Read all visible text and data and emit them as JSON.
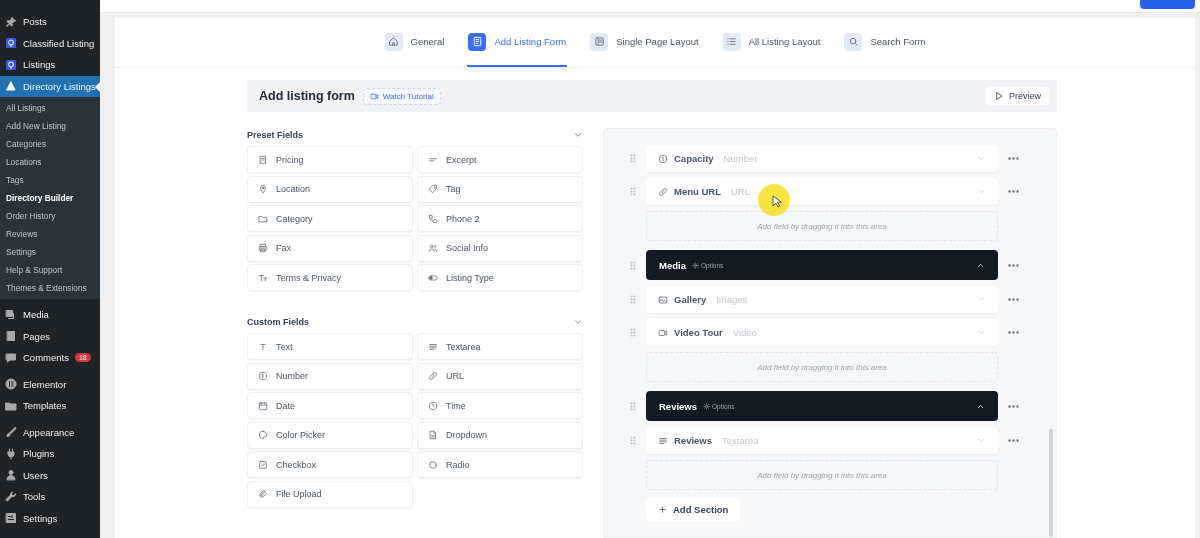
{
  "sidebar": {
    "groups": [
      {
        "items": [
          {
            "label": "Posts",
            "selected": false
          },
          {
            "label": "Classified Listing",
            "selected": false
          },
          {
            "label": "Listings",
            "selected": false
          },
          {
            "label": "Directory Listings",
            "selected": true,
            "children": [
              {
                "label": "All Listings",
                "selected": false
              },
              {
                "label": "Add New Listing",
                "selected": false
              },
              {
                "label": "Categories",
                "selected": false
              },
              {
                "label": "Locations",
                "selected": false
              },
              {
                "label": "Tags",
                "selected": false
              },
              {
                "label": "Directory Builder",
                "selected": true
              },
              {
                "label": "Order History",
                "selected": false
              },
              {
                "label": "Reviews",
                "selected": false
              },
              {
                "label": "Settings",
                "selected": false
              },
              {
                "label": "Help & Support",
                "selected": false
              },
              {
                "label": "Themes & Extensions",
                "selected": false
              }
            ]
          }
        ]
      },
      {
        "items": [
          {
            "label": "Media",
            "selected": false
          },
          {
            "label": "Pages",
            "selected": false
          },
          {
            "label": "Comments",
            "selected": false,
            "badge": "18"
          }
        ]
      },
      {
        "items": [
          {
            "label": "Elementor",
            "selected": false
          },
          {
            "label": "Templates",
            "selected": false
          }
        ]
      },
      {
        "items": [
          {
            "label": "Appearance",
            "selected": false
          },
          {
            "label": "Plugins",
            "selected": false
          },
          {
            "label": "Users",
            "selected": false
          },
          {
            "label": "Tools",
            "selected": false
          },
          {
            "label": "Settings",
            "selected": false
          }
        ]
      }
    ]
  },
  "tabs": [
    {
      "label": "General",
      "selected": false
    },
    {
      "label": "Add Listing Form",
      "selected": true
    },
    {
      "label": "Single Page Layout",
      "selected": false
    },
    {
      "label": "All Listing Layout",
      "selected": false
    },
    {
      "label": "Search Form",
      "selected": false
    }
  ],
  "header": {
    "title": "Add listing form",
    "tutorial": "Watch Tutorial",
    "preview": "Preview"
  },
  "palette": [
    {
      "title": "Preset Fields",
      "expanded": true,
      "fields": [
        "Pricing",
        "Excerpt",
        "Location",
        "Tag",
        "Category",
        "Phone 2",
        "Fax",
        "Social Info",
        "Terms & Privacy",
        "Listing Type"
      ]
    },
    {
      "title": "Custom Fields",
      "expanded": true,
      "fields": [
        "Text",
        "Textarea",
        "Number",
        "URL",
        "Date",
        "Time",
        "Color Picker",
        "Dropdown",
        "Checkbox",
        "Radio",
        "File Upload"
      ]
    }
  ],
  "canvas": {
    "items": [
      {
        "kind": "field",
        "label": "Capacity",
        "type": "Number",
        "expanded": false
      },
      {
        "kind": "field",
        "label": "Menu URL",
        "type": "URL",
        "expanded": false
      },
      {
        "kind": "dropzone",
        "text": "Add field by dragging it into this area"
      },
      {
        "kind": "section",
        "label": "Media",
        "options": "Options",
        "expanded": true
      },
      {
        "kind": "field",
        "label": "Gallery",
        "type": "Images",
        "expanded": false
      },
      {
        "kind": "field",
        "label": "Video Tour",
        "type": "Video",
        "expanded": false
      },
      {
        "kind": "dropzone",
        "text": "Add field by dragging it into this area"
      },
      {
        "kind": "section",
        "label": "Reviews",
        "options": "Options",
        "expanded": true
      },
      {
        "kind": "field",
        "label": "Reviews",
        "type": "Textarea",
        "expanded": false
      },
      {
        "kind": "dropzone",
        "text": "Add field by dragging it into this area"
      }
    ],
    "add_section": "Add Section"
  }
}
